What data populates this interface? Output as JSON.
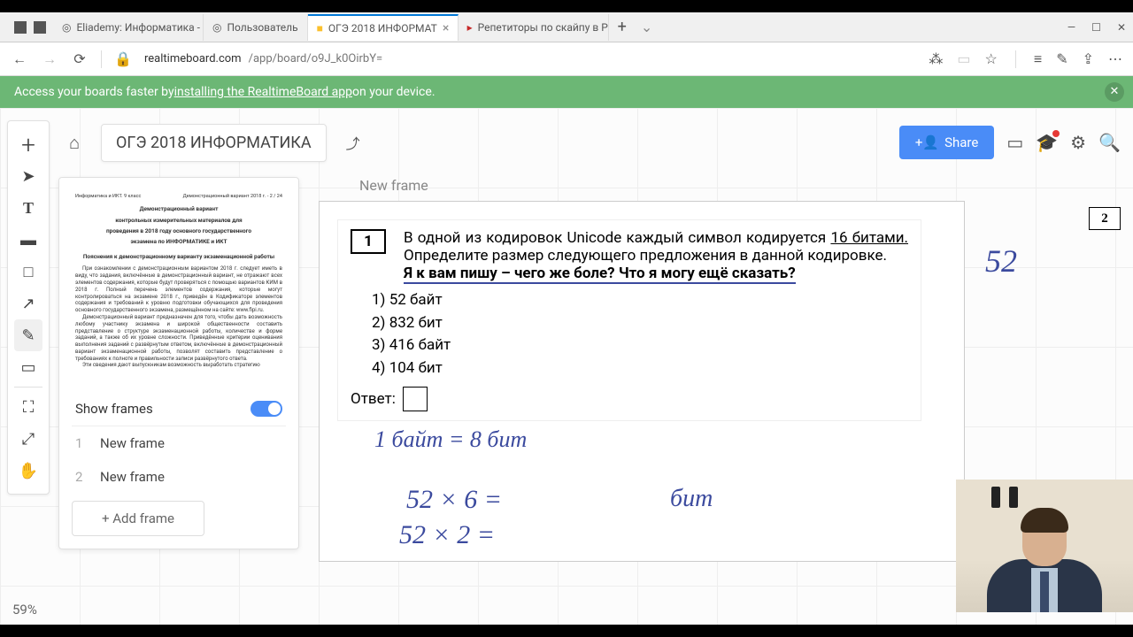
{
  "tabs": [
    {
      "label": "Eliademy: Информатика - С",
      "active": false
    },
    {
      "label": "Пользователь",
      "active": false
    },
    {
      "label": "ОГЭ 2018 ИНФОРМАТ",
      "active": true
    },
    {
      "label": "Репетиторы по скайпу в Pr",
      "active": false
    }
  ],
  "url": {
    "host": "realtimeboard.com",
    "path": "/app/board/o9J_k0OirbY="
  },
  "banner": {
    "prefix": "Access your boards faster by ",
    "link": "installing the RealtimeBoard app",
    "suffix": " on your device."
  },
  "board": {
    "title": "ОГЭ 2018 ИНФОРМАТИКА",
    "share": "Share"
  },
  "frames": {
    "title": "Show frames",
    "items": [
      {
        "n": "1",
        "label": "New frame"
      },
      {
        "n": "2",
        "label": "New frame"
      }
    ],
    "add": "+ Add frame"
  },
  "canvas": {
    "frame_label": "New frame"
  },
  "problem": {
    "num": "1",
    "text_a": "В одной из кодировок Unicode каждый символ кодируется ",
    "text_u": "16 битами.",
    "text_b": " Определите размер следующего предложения в данной кодировке.",
    "quote": "Я к вам пишу – чего же боле? Что я могу ещё сказать?",
    "options": [
      "1)  52 байт",
      "2)  832 бит",
      "3)  416 байт",
      "4)  104 бит"
    ],
    "answer": "Ответ:"
  },
  "handwriting": {
    "big52": "52",
    "bytes": "1 байт = 8 бит",
    "calc1": "52 × 6  =",
    "calc2": "52 × 2  =",
    "bit": "бит"
  },
  "page_marker": "2",
  "zoom": "59%",
  "doc_preview": {
    "hdr_l": "Информатика и ИКТ. 9 класс",
    "hdr_r": "Демонстрационный вариант 2018 г. - 2 / 24",
    "t1a": "Демонстрационный вариант",
    "t1b": "контрольных измерительных материалов для",
    "t1c": "проведения в 2018 году основного государственного",
    "t1d": "экзамена по ИНФОРМАТИКЕ и ИКТ",
    "t2": "Пояснения к демонстрационному варианту экзаменационной работы",
    "p1": "При ознакомлении с демонстрационным вариантом 2018 г. следует иметь в виду, что задания, включённые в демонстрационный вариант, не отражают всех элементов содержания, которые будут проверяться с помощью вариантов КИМ в 2018 г. Полный перечень элементов содержания, которые могут контролироваться на экзамене 2018 г., приведён в Кодификаторе элементов содержания и требований к уровню подготовки обучающихся для проведения основного государственного экзамена, размещённом на сайте: www.fipi.ru.",
    "p2": "Демонстрационный вариант предназначен для того, чтобы дать возможность любому участнику экзамена и широкой общественности составить представление о структуре экзаменационной работы, количестве и форме заданий, а также об их уровне сложности. Приведённые критерии оценивания выполнения заданий с развёрнутым ответом, включённые в демонстрационный вариант экзаменационной работы, позволят составить представление о требованиях к полноте и правильности записи развёрнутого ответа.",
    "p3": "Эти сведения дают выпускникам возможность выработать стратегию"
  }
}
